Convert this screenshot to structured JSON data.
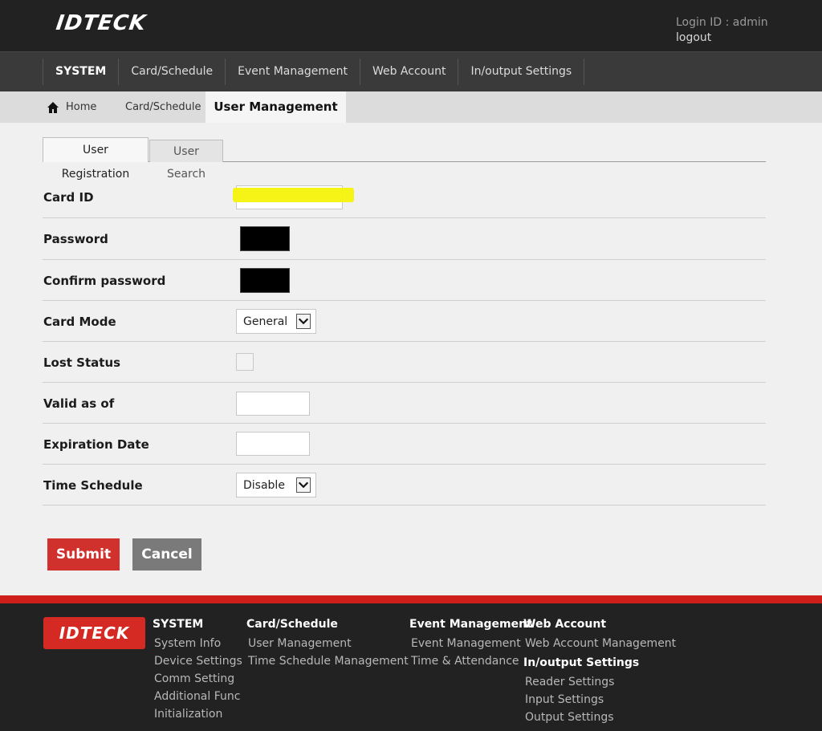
{
  "header": {
    "logo": "IDTECK",
    "login_label": "Login ID : admin",
    "logout": "logout"
  },
  "nav": {
    "items": [
      "SYSTEM",
      "Card/Schedule",
      "Event Management",
      "Web Account",
      "In/output Settings"
    ],
    "active": "SYSTEM"
  },
  "breadcrumb": {
    "home": "Home",
    "section": "Card/Schedule",
    "current": "User Management"
  },
  "tabs": {
    "registration": "User Registration",
    "search": "User Search"
  },
  "form": {
    "card_id_label": "Card ID",
    "password_label": "Password",
    "confirm_password_label": "Confirm password",
    "card_mode_label": "Card Mode",
    "card_mode_value": "General",
    "lost_status_label": "Lost Status",
    "valid_as_of_label": "Valid as of",
    "expiration_label": "Expiration Date",
    "time_schedule_label": "Time Schedule",
    "time_schedule_value": "Disable"
  },
  "buttons": {
    "submit": "Submit",
    "cancel": "Cancel"
  },
  "footer": {
    "logo": "IDTECK",
    "system_head": "SYSTEM",
    "system_links": [
      "System Info",
      "Device Settings",
      "Comm Setting",
      "Additional Func",
      "Initialization"
    ],
    "card_head": "Card/Schedule",
    "card_links": [
      "User Management",
      "Time Schedule Management"
    ],
    "event_head": "Event Management",
    "event_links": [
      "Event Management",
      "Time & Attendance"
    ],
    "web_head": "Web Account",
    "web_links": [
      "Web Account Management"
    ],
    "io_head": "In/output Settings",
    "io_links": [
      "Reader Settings",
      "Input Settings",
      "Output Settings"
    ]
  },
  "colors": {
    "header_bg": "#222222",
    "accent_red": "#d0312d",
    "highlight": "#f5f20a"
  }
}
